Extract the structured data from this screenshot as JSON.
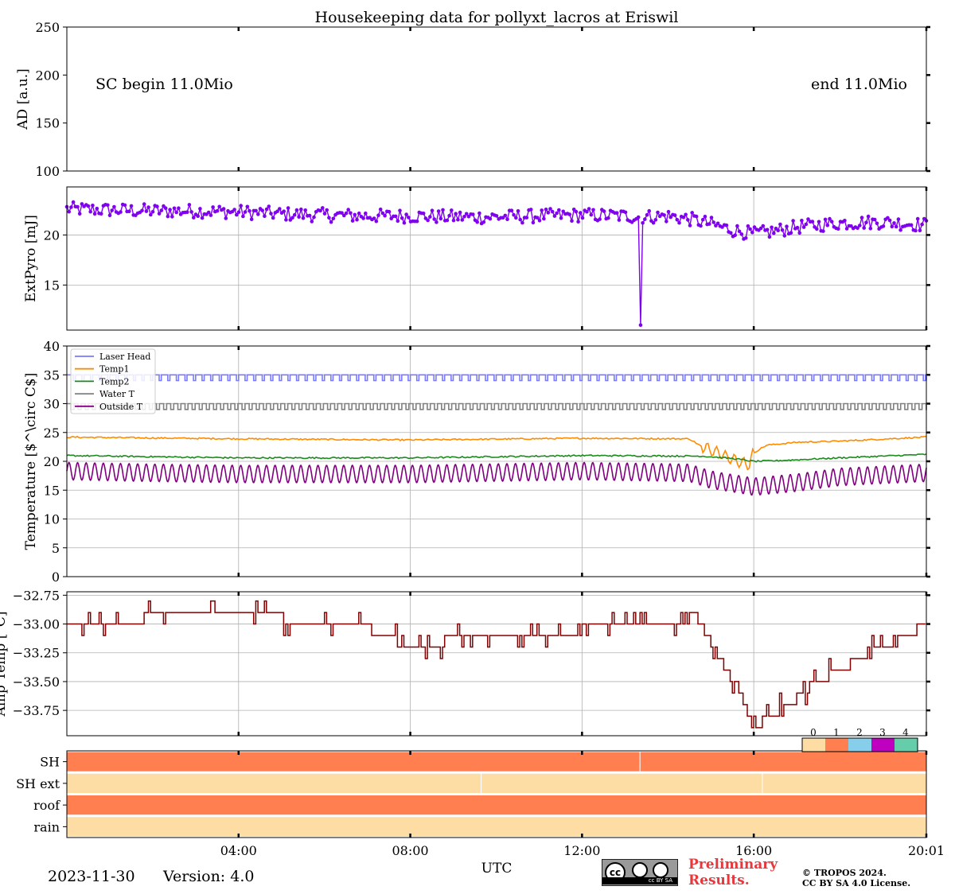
{
  "title": "Housekeeping data for pollyxt_lacros at Eriswil",
  "date": "2023-11-30",
  "version": "Version: 4.0",
  "xlabel": "UTC",
  "colors": {
    "pyro": "#8000f0",
    "laser_head": "#7a7aff",
    "temp1": "#ff8c00",
    "temp2": "#1b8c1b",
    "water": "#808080",
    "outside": "#800080",
    "amp": "#800000",
    "status_0": "#fddda4",
    "status_1": "#ff7f50",
    "status_2": "#87ceeb",
    "status_3": "#c000c0",
    "status_4": "#66cdaa"
  },
  "logo": {
    "badge_text": "cc BY SA",
    "preliminary": "Preliminary",
    "results": "Results.",
    "copyright": "© TROPOS 2024.",
    "license": "CC BY SA 4.0 License."
  },
  "chart_data": [
    {
      "type": "line",
      "panel": "AD",
      "ylabel": "AD [a.u.]",
      "ylim": [
        100,
        250
      ],
      "yticks": [
        100,
        150,
        200,
        250
      ],
      "xlim": [
        0,
        20.02
      ],
      "xtick_labels": [
        "04:00",
        "08:00",
        "12:00",
        "16:00",
        "20:01"
      ],
      "annotations": {
        "left": "SC begin 11.0Mio",
        "right": "end 11.0Mio"
      },
      "grid": false
    },
    {
      "type": "line",
      "panel": "ExtPyro",
      "ylabel": "ExtPyro [mJ]",
      "ylim": [
        10.5,
        24.8
      ],
      "yticks": [
        15,
        20
      ],
      "grid": true,
      "series": [
        {
          "name": "ExtPyro",
          "x": [
            0,
            1,
            2,
            3,
            4,
            5,
            6,
            7,
            8,
            9,
            10,
            11,
            12,
            13,
            13.35,
            14,
            14.5,
            15,
            15.5,
            16,
            16.5,
            17,
            18,
            19,
            20
          ],
          "y": [
            22.6,
            22.5,
            22.4,
            22.4,
            22.3,
            22.1,
            22.0,
            21.9,
            21.9,
            21.8,
            21.8,
            21.9,
            22.0,
            21.9,
            21.8,
            21.9,
            21.6,
            21.1,
            20.5,
            20.1,
            20.4,
            20.8,
            21.2,
            21.3,
            21.0
          ],
          "outlier": {
            "x": 13.35,
            "y": 11.0
          },
          "noise_amplitude": 0.7
        }
      ]
    },
    {
      "type": "line",
      "panel": "Temperature",
      "ylabel": "Temperature [$^\\circ C$]",
      "ylim": [
        0,
        40
      ],
      "yticks": [
        0,
        5,
        10,
        15,
        20,
        25,
        30,
        35,
        40
      ],
      "grid": true,
      "legend": "top-left",
      "series": [
        {
          "name": "Laser Head",
          "baseline": 35.0,
          "dip": 34.0
        },
        {
          "name": "Temp1",
          "x": [
            0,
            4,
            8,
            12,
            14.5,
            14.8,
            15.2,
            15.6,
            15.9,
            16.0,
            16.3,
            17,
            18,
            20
          ],
          "y": [
            24.2,
            23.9,
            23.7,
            24.0,
            23.9,
            22.5,
            21.5,
            20.0,
            19.5,
            21.5,
            22.8,
            23.3,
            23.5,
            24.2
          ]
        },
        {
          "name": "Temp2",
          "x": [
            0,
            4,
            8,
            12,
            14.8,
            15.5,
            16,
            16.5,
            18,
            20
          ],
          "y": [
            21.0,
            20.6,
            20.6,
            21.0,
            20.9,
            20.5,
            20.0,
            20.1,
            20.6,
            21.2
          ]
        },
        {
          "name": "Water T",
          "baseline": 30.0,
          "dip": 29.0
        },
        {
          "name": "Outside T",
          "x": [
            0,
            2,
            4,
            8,
            12,
            14.5,
            15,
            16,
            17,
            18,
            20
          ],
          "y": [
            18.3,
            18.0,
            17.8,
            17.8,
            18.3,
            18.0,
            16.8,
            15.6,
            16.3,
            17.3,
            18.0
          ],
          "amplitude": 1.5
        }
      ]
    },
    {
      "type": "line",
      "panel": "Amp Temp",
      "ylabel": "Amp Temp [°C]",
      "ylim": [
        -33.97,
        -32.72
      ],
      "yticks": [
        -33.75,
        -33.5,
        -33.25,
        -33.0,
        -32.75
      ],
      "ytick_labels": [
        "−33.75",
        "−33.50",
        "−33.25",
        "−33.00",
        "−32.75"
      ],
      "grid": true,
      "series": [
        {
          "name": "Amp Temp",
          "x": [
            0,
            0.3,
            3.2,
            6.8,
            7.3,
            8.0,
            8.5,
            9.1,
            12.0,
            14.0,
            14.6,
            14.9,
            15.2,
            15.5,
            15.8,
            16.0,
            16.4,
            16.8,
            17.2,
            17.5,
            18.0,
            18.5,
            19.0,
            19.5,
            20.0
          ],
          "y": [
            -33.0,
            -33.0,
            -32.9,
            -33.0,
            -33.1,
            -33.2,
            -33.2,
            -33.1,
            -33.05,
            -33.0,
            -32.9,
            -33.1,
            -33.3,
            -33.5,
            -33.7,
            -33.9,
            -33.8,
            -33.7,
            -33.6,
            -33.5,
            -33.4,
            -33.3,
            -33.2,
            -33.1,
            -33.0
          ]
        }
      ]
    },
    {
      "type": "heatmap",
      "panel": "Status",
      "rows": [
        "SH",
        "SH ext",
        "roof",
        "rain"
      ],
      "colorbar_labels": [
        "0",
        "1",
        "2",
        "3",
        "4"
      ],
      "segments": [
        [
          {
            "from": 0,
            "to": 13.35,
            "value": 1
          },
          {
            "from": 13.35,
            "to": 20.02,
            "value": 1
          }
        ],
        [
          {
            "from": 0,
            "to": 9.65,
            "value": 0
          },
          {
            "from": 9.65,
            "to": 16.2,
            "value": 0
          },
          {
            "from": 16.2,
            "to": 20.02,
            "value": 0
          }
        ],
        [
          {
            "from": 0,
            "to": 20.02,
            "value": 1
          }
        ],
        [
          {
            "from": 0,
            "to": 20.02,
            "value": 0
          }
        ]
      ]
    }
  ]
}
